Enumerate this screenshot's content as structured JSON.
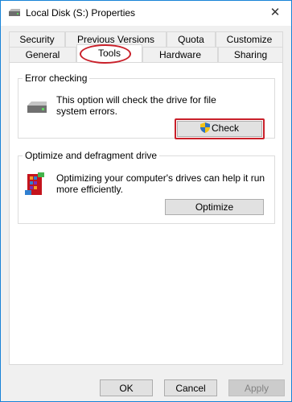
{
  "window": {
    "title": "Local Disk (S:) Properties",
    "close_glyph": "✕"
  },
  "tabs": {
    "row_back": [
      "Security",
      "Previous Versions",
      "Quota",
      "Customize"
    ],
    "row_front": [
      "General",
      "Tools",
      "Hardware",
      "Sharing"
    ],
    "active": "Tools"
  },
  "error_checking": {
    "title": "Error checking",
    "description_line1": "This option will check the drive for file",
    "description_line2": "system errors.",
    "button_label": "Check",
    "icon": "drive-icon",
    "button_icon": "uac-shield-icon"
  },
  "optimize": {
    "title": "Optimize and defragment drive",
    "description_line1": "Optimizing your computer's drives can help it run",
    "description_line2": "more efficiently.",
    "button_label": "Optimize",
    "icon": "defrag-icon"
  },
  "footer": {
    "ok_label": "OK",
    "cancel_label": "Cancel",
    "apply_label": "Apply"
  },
  "colors": {
    "highlight": "#c9202a",
    "window_border": "#1883d7"
  }
}
